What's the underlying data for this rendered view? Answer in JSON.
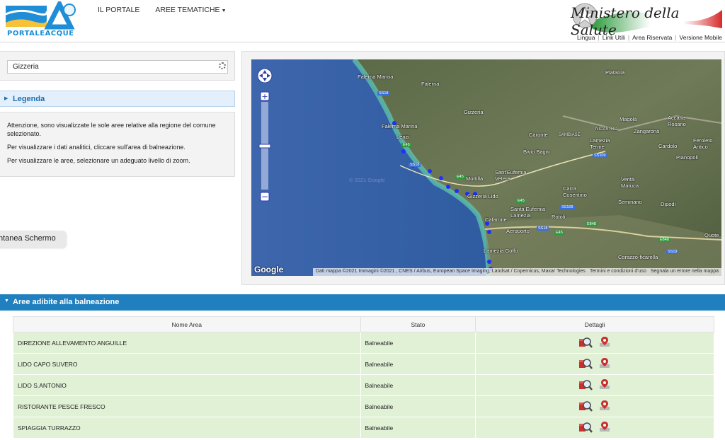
{
  "header": {
    "logo_text": "PORTALEACQUE",
    "nav": [
      {
        "label": "IL PORTALE"
      },
      {
        "label": "AREE TEMATICHE"
      }
    ],
    "ministry_text": "Ministero della Salute",
    "util_links": [
      "Lingua",
      "Link Utili",
      "Area Riservata",
      "Versione Mobile"
    ]
  },
  "search": {
    "value": "Gizzeria"
  },
  "legend": {
    "label": "Legenda"
  },
  "info": {
    "lines": [
      "Attenzione, sono visualizzate le sole aree relative alla regione del comune selezionato.",
      "Per visualizzare i dati analitici, cliccare sull'area di balneazione.",
      "Per visualizzare le aree, selezionare un adeguato livello di zoom."
    ]
  },
  "screen_button": {
    "label": "ntanea Schermo"
  },
  "map": {
    "places": [
      "Falerna Marina",
      "Falerna",
      "Platania",
      "Gizzeria",
      "Falerna Marina",
      "Lenzi",
      "Caronte",
      "SAMBIASE",
      "NICASTRO",
      "Magolà",
      "Accaria Rosario",
      "Zangarona",
      "Lamezia Terme",
      "Cardolo",
      "Feroleto Antico",
      "Bivio Bagni",
      "Mortilla",
      "Sant'Eufemia Vetere",
      "Pianopoli",
      "Gizzeria Lido",
      "Carra Cosentino",
      "Verità Maruca",
      "Santa Eufemia Lamezia",
      "Rotoli",
      "Seminario",
      "Dipodi",
      "Cafarone",
      "Aeroporto",
      "Quote",
      "Lamezia Golfo",
      "Corazzo-ficarella"
    ],
    "roads": [
      "SS18",
      "SS18",
      "E45",
      "E45",
      "E45",
      "SS109",
      "SS109",
      "SS18",
      "E45",
      "E848",
      "E848",
      "SS19"
    ],
    "watermark": "© 2021 Google",
    "google": "Google",
    "attribution": [
      "Dati mappa ©2021 Immagini ©2021 , CNES / Airbus, European Space Imaging, Landsat / Copernicus, Maxar Technologies",
      "Termini e condizioni d'uso",
      "Segnala un errore nella mappa"
    ]
  },
  "results": {
    "title": "Aree adibite alla balneazione",
    "columns": [
      "Nome Area",
      "Stato",
      "Dettagli"
    ],
    "rows": [
      {
        "name": "DIREZIONE ALLEVAMENTO ANGUILLE",
        "status": "Balneabile"
      },
      {
        "name": "LIDO CAPO SUVERO",
        "status": "Balneabile"
      },
      {
        "name": "LIDO S.ANTONIO",
        "status": "Balneabile"
      },
      {
        "name": "RISTORANTE PESCE FRESCO",
        "status": "Balneabile"
      },
      {
        "name": "SPIAGGIA TURRAZZO",
        "status": "Balneabile"
      }
    ]
  },
  "colors": {
    "accent": "#1f7fbf",
    "row_ok": "#e1f1d6",
    "legend_bg": "#e3effa"
  }
}
